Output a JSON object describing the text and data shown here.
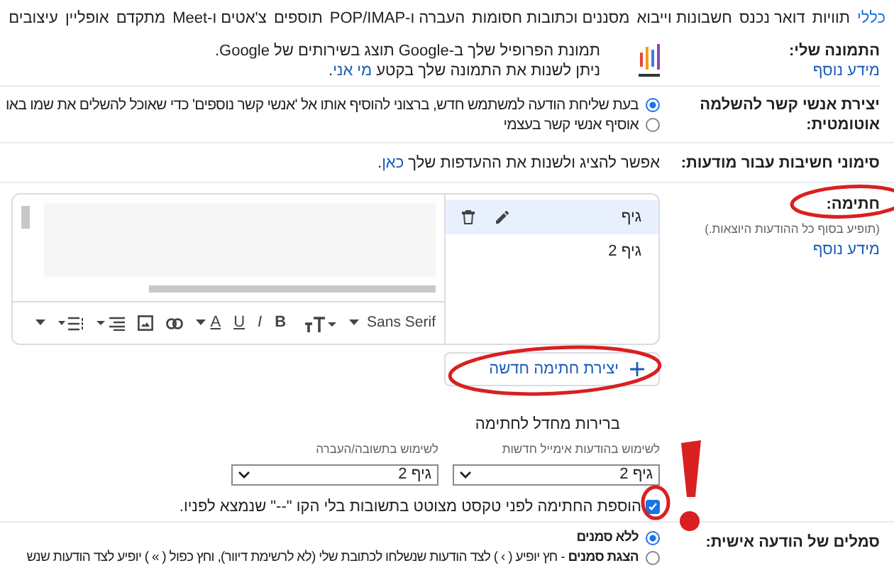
{
  "tabs": [
    {
      "label": "כללי",
      "selected": true
    },
    {
      "label": "תוויות",
      "selected": false
    },
    {
      "label": "דואר נכנס",
      "selected": false
    },
    {
      "label": "חשבונות וייבוא",
      "selected": false
    },
    {
      "label": "מסננים וכתובות חסומות",
      "selected": false
    },
    {
      "label": "העברה ו-POP/IMAP",
      "selected": false
    },
    {
      "label": "תוספים",
      "selected": false
    },
    {
      "label": "צ'אטים ו-Meet",
      "selected": false
    },
    {
      "label": "מתקדם",
      "selected": false
    },
    {
      "label": "אופליין",
      "selected": false
    },
    {
      "label": "עיצובים",
      "selected": false
    }
  ],
  "profile_picture": {
    "label": "התמונה שלי:",
    "link": "מידע נוסף",
    "line_1": "תמונת הפרופיל שלך ב-Google תוצג בשירותים של Google.",
    "line_2": "ניתן לשנות את התמונה שלך בקטע",
    "line_2_link": "מי אני",
    "line_2_end": "."
  },
  "auto_contacts": {
    "label": "יצירת אנשי קשר להשלמה אוטומטית:",
    "options": [
      {
        "label": "בעת שליחת הודעה למשתמש חדש, ברצוני להוסיף אותו אל 'אנשי קשר נוספים' כדי שאוכל להשלים את שמו באו",
        "selected": true
      },
      {
        "label": "אוסיף אנשי קשר בעצמי",
        "selected": false
      }
    ]
  },
  "importance": {
    "label": "סימוני חשיבות עבור מודעות:",
    "text": "אפשר להציג ולשנות את ההעדפות שלך",
    "link": "כאן",
    "end": "."
  },
  "signature": {
    "label": "חתימה:",
    "note": "(תופיע בסוף כל ההודעות היוצאות.)",
    "link": "מידע נוסף",
    "items": [
      {
        "name": "גיף",
        "selected": true
      },
      {
        "name": "גיף 2",
        "selected": false
      }
    ],
    "toolbar": [
      {
        "kind": "font",
        "text": "Sans Serif"
      },
      {
        "kind": "size"
      },
      {
        "kind": "letter",
        "text": "B"
      },
      {
        "kind": "italic",
        "text": "I"
      },
      {
        "kind": "underline",
        "text": "U"
      },
      {
        "kind": "color",
        "text": "A"
      },
      {
        "kind": "link"
      },
      {
        "kind": "image"
      },
      {
        "kind": "align"
      },
      {
        "kind": "list"
      },
      {
        "kind": "more"
      }
    ],
    "create_button": "יצירת חתימה חדשה",
    "defaults_title": "ברירות מחדל לחתימה",
    "new_label": "לשימוש בהודעות אימייל חדשות",
    "new_value": "גיף 2",
    "reply_label": "לשימוש בתשובה/העברה",
    "reply_value": "גיף 2",
    "insert_before": {
      "label": "הוספת החתימה לפני טקסט מצוטט בתשובות בלי הקו \"--\" שנמצא לפניו.",
      "checked": true
    }
  },
  "indicators": {
    "label": "סמלים של הודעה אישית:",
    "options": [
      {
        "title": "ללא סמנים",
        "selected": true
      },
      {
        "title": "הצגת סמנים",
        "description": " - חץ יופיע ( › ) לצד הודעות שנשלחו לכתובת שלי (לא לרשימת דיוור), וחץ כפול ( » ) יופיע לצד הודעות שנש",
        "selected": false
      }
    ]
  }
}
